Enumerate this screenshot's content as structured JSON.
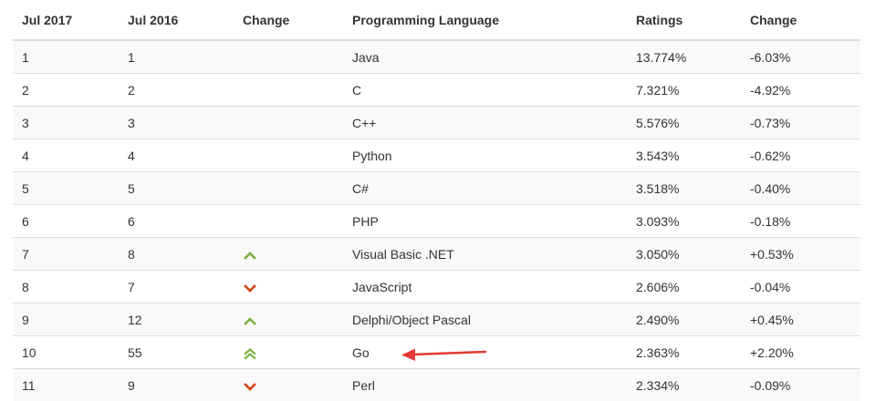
{
  "headers": {
    "rank_current": "Jul 2017",
    "rank_previous": "Jul 2016",
    "change_icon": "Change",
    "language": "Programming Language",
    "ratings": "Ratings",
    "change_pct": "Change"
  },
  "rows": [
    {
      "rank_current": "1",
      "rank_previous": "1",
      "trend": "none",
      "language": "Java",
      "ratings": "13.774%",
      "change": "-6.03%"
    },
    {
      "rank_current": "2",
      "rank_previous": "2",
      "trend": "none",
      "language": "C",
      "ratings": "7.321%",
      "change": "-4.92%"
    },
    {
      "rank_current": "3",
      "rank_previous": "3",
      "trend": "none",
      "language": "C++",
      "ratings": "5.576%",
      "change": "-0.73%"
    },
    {
      "rank_current": "4",
      "rank_previous": "4",
      "trend": "none",
      "language": "Python",
      "ratings": "3.543%",
      "change": "-0.62%"
    },
    {
      "rank_current": "5",
      "rank_previous": "5",
      "trend": "none",
      "language": "C#",
      "ratings": "3.518%",
      "change": "-0.40%"
    },
    {
      "rank_current": "6",
      "rank_previous": "6",
      "trend": "none",
      "language": "PHP",
      "ratings": "3.093%",
      "change": "-0.18%"
    },
    {
      "rank_current": "7",
      "rank_previous": "8",
      "trend": "up",
      "language": "Visual Basic .NET",
      "ratings": "3.050%",
      "change": "+0.53%"
    },
    {
      "rank_current": "8",
      "rank_previous": "7",
      "trend": "down",
      "language": "JavaScript",
      "ratings": "2.606%",
      "change": "-0.04%"
    },
    {
      "rank_current": "9",
      "rank_previous": "12",
      "trend": "up",
      "language": "Delphi/Object Pascal",
      "ratings": "2.490%",
      "change": "+0.45%"
    },
    {
      "rank_current": "10",
      "rank_previous": "55",
      "trend": "double-up",
      "language": "Go",
      "ratings": "2.363%",
      "change": "+2.20%"
    },
    {
      "rank_current": "11",
      "rank_previous": "9",
      "trend": "down",
      "language": "Perl",
      "ratings": "2.334%",
      "change": "-0.09%"
    }
  ],
  "icons": {
    "up": "chevron-up-icon",
    "down": "chevron-down-icon",
    "double-up": "double-chevron-up-icon"
  },
  "colors": {
    "up": "#7cb342",
    "down": "#d84315",
    "arrow": "#e53935",
    "row_stripe": "#f9f9f9",
    "border": "#dddddd"
  },
  "annotation": {
    "icon": "annotation-arrow-icon",
    "points_to_row": 9
  }
}
